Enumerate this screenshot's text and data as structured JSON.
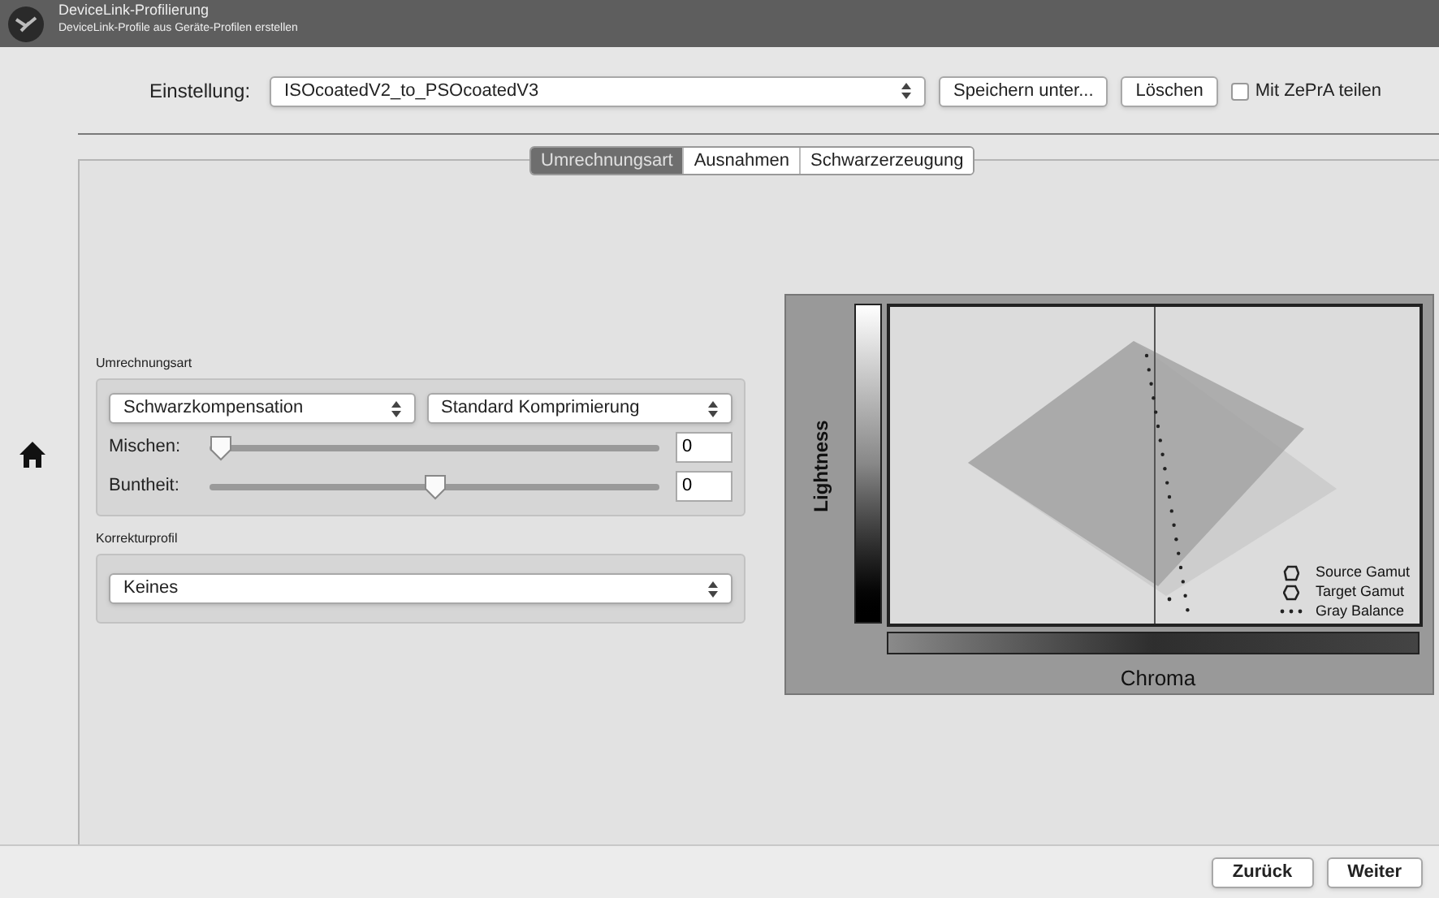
{
  "window": {
    "title": "DeviceLink-Profilierung",
    "subtitle": "DeviceLink-Profile aus Geräte-Profilen erstellen"
  },
  "toolbar": {
    "label": "Einstellung:",
    "value": "ISOcoatedV2_to_PSOcoatedV3",
    "buttons": [
      "Speichern unter...",
      "Löschen"
    ],
    "share": {
      "label": "Mit ZePrA teilen",
      "checked": false
    }
  },
  "tabs": [
    {
      "label": "Umrechnungsart",
      "selected": true
    },
    {
      "label": "Ausnahmen",
      "selected": false
    },
    {
      "label": "Schwarzerzeugung",
      "selected": false
    }
  ],
  "conversion": {
    "title": "Umrechnungsart",
    "selects": [
      "Schwarzkompensation",
      "Standard Komprimierung"
    ],
    "sliders": [
      {
        "label": "Mischen:",
        "level": 0,
        "value": "0"
      },
      {
        "label": "Buntheit:",
        "level": 0.5,
        "value": "0"
      }
    ]
  },
  "correction": {
    "title": "Korrekturprofil",
    "value": "Keines"
  },
  "gamut_view": {
    "ylabel": "Lightness",
    "xlabel": "Chroma",
    "legend": [
      {
        "label": "Source Gamut",
        "kind": "source"
      },
      {
        "label": "Target Gamut",
        "kind": "target"
      },
      {
        "label": "Gray Balance",
        "kind": "gray"
      }
    ]
  },
  "footer": {
    "buttons": [
      "Zurück",
      "Weiter"
    ]
  }
}
